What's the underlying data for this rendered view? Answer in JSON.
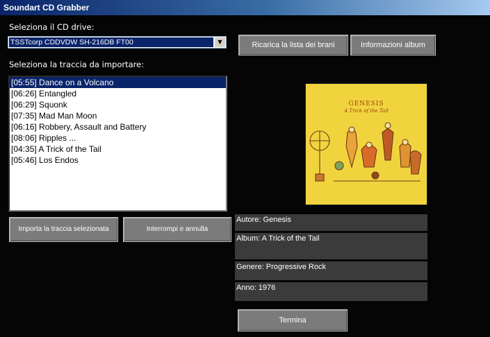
{
  "window": {
    "title": "Soundart CD Grabber"
  },
  "drive": {
    "label": "Seleziona il CD drive:",
    "selected": "TSSTcorp CDDVDW SH-216DB FT00"
  },
  "toolbar": {
    "reload_label": "Ricarica la lista dei brani",
    "album_info_label": "Informazioni album"
  },
  "tracks": {
    "label": "Seleziona la traccia da importare:",
    "items": [
      "[05:55] Dance on a Volcano",
      "[06:26] Entangled",
      "[06:29] Squonk",
      "[07:35] Mad Man Moon",
      "[06:16] Robbery, Assault and Battery",
      "[08:06] Ripples ...",
      "[04:35] A Trick of the Tail",
      "[05:46] Los Endos"
    ]
  },
  "actions": {
    "import_label": "Importa la traccia selezionata",
    "stop_label": "Interrompi e annulla",
    "finish_label": "Termina"
  },
  "album": {
    "cover_band": "GENESIS",
    "cover_title": "A Trick of the Tail",
    "author": "Autore: Genesis",
    "album": "Album: A Trick of the Tail",
    "genre": "Genere: Progressive Rock",
    "year": "Anno: 1976"
  }
}
